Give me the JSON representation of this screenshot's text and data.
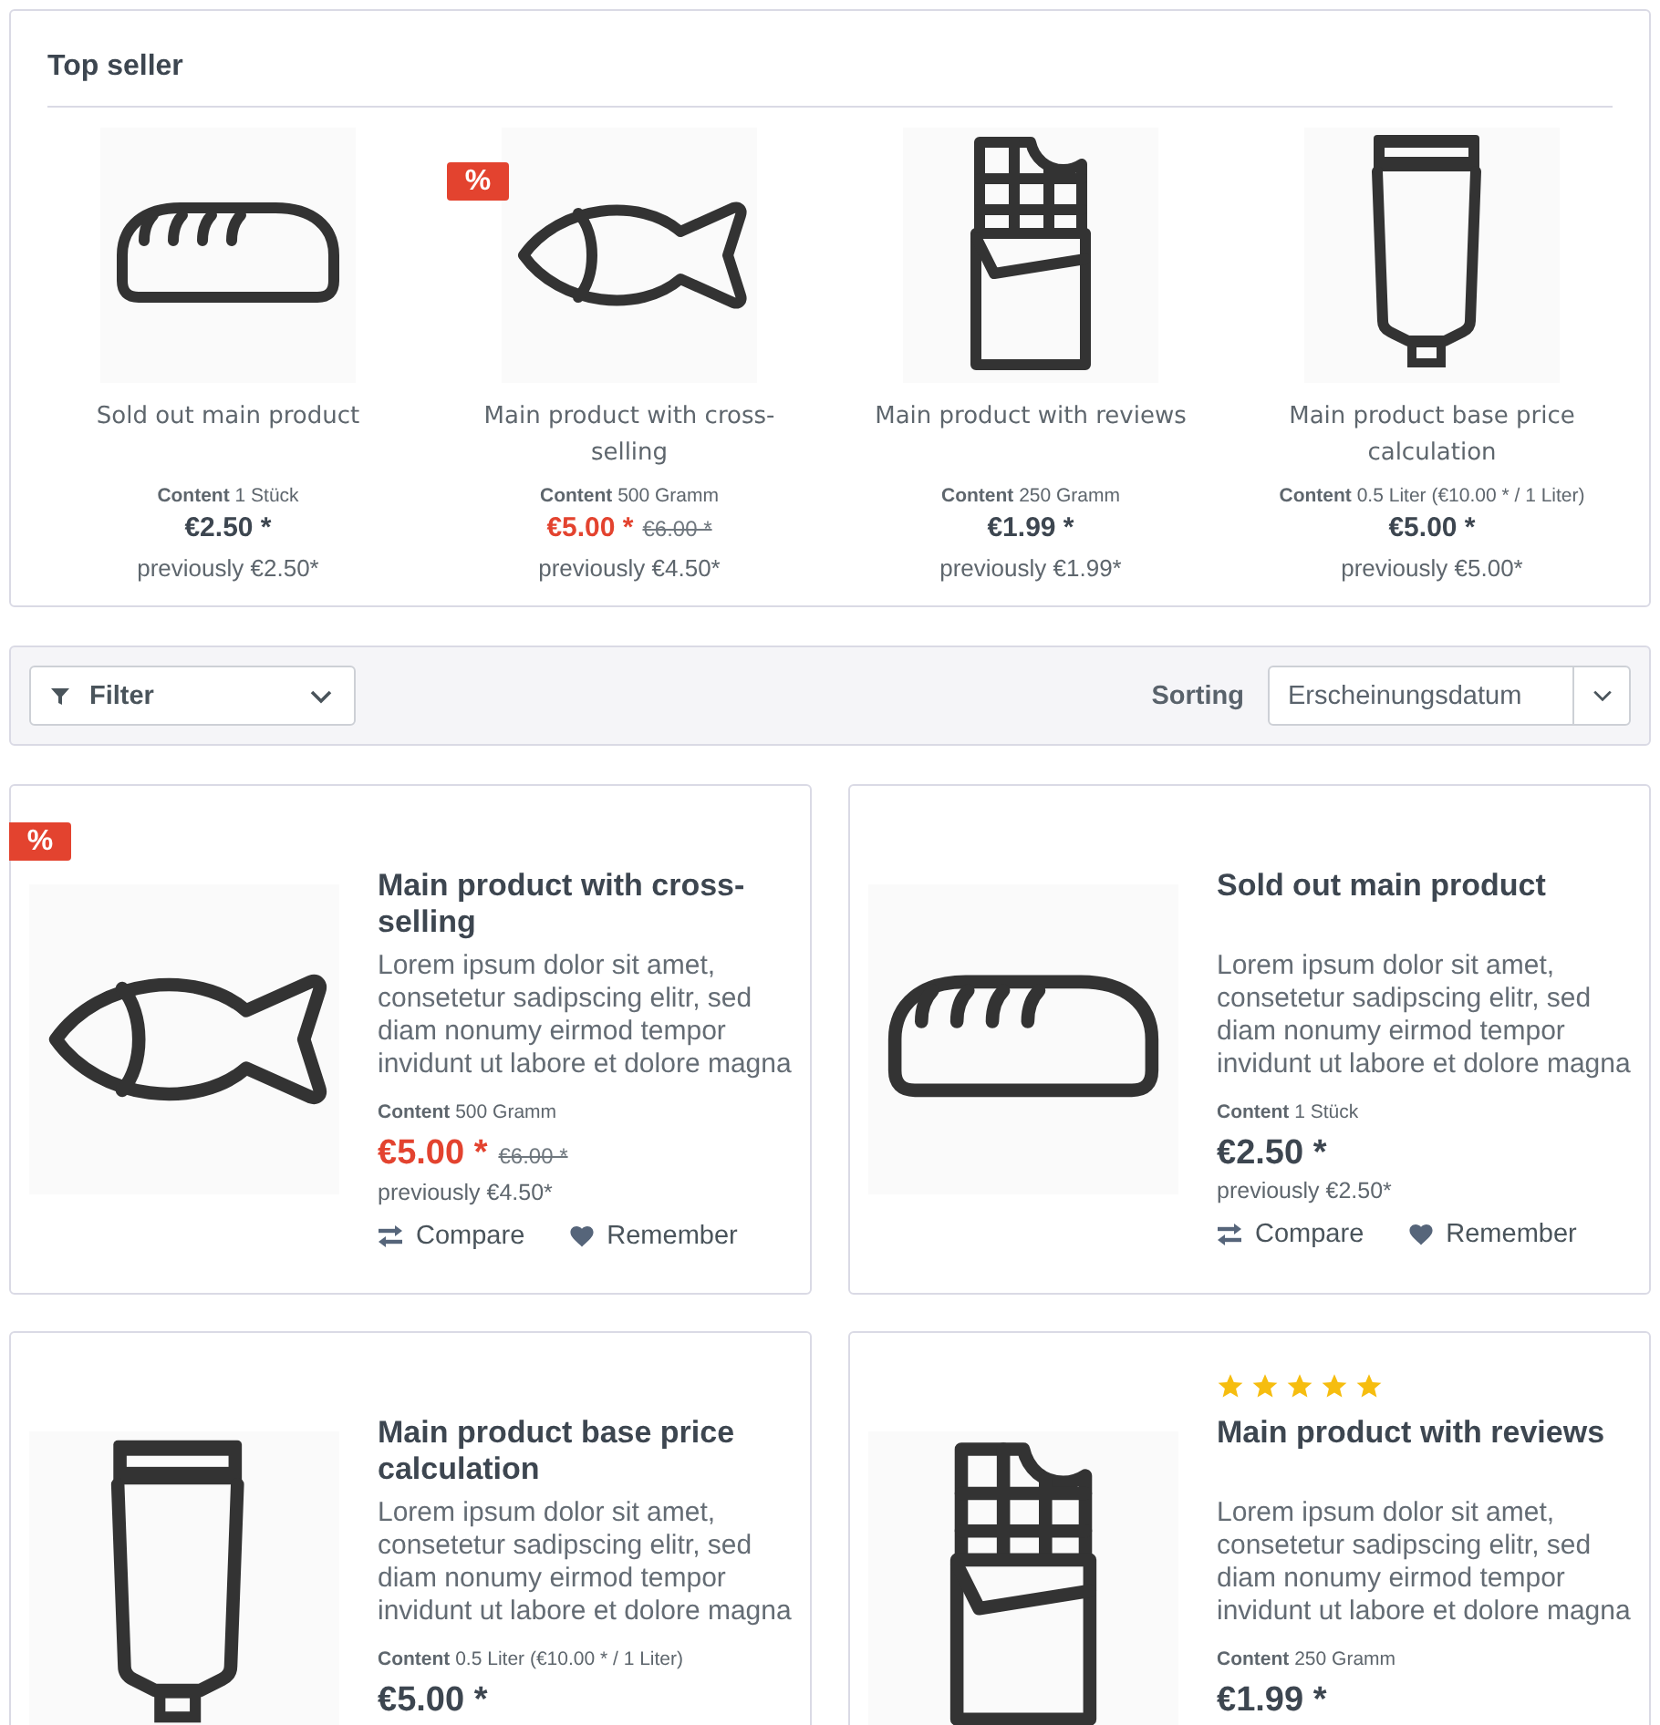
{
  "top_seller": {
    "title": "Top seller",
    "items": [
      {
        "kind": "bread",
        "name": "Sold out main product",
        "content": "**Content** 1 Stück",
        "price": "€2.50 *",
        "discounted": false,
        "previously": "previously €2.50*"
      },
      {
        "kind": "fish",
        "badge": "%",
        "name": "Main product with cross-selling",
        "content": "**Content** 500 Gramm",
        "price": "€5.00 *",
        "discounted": true,
        "list_price": "€6.00 *",
        "previously": "previously €4.50*"
      },
      {
        "kind": "chocolate",
        "name": "Main product with reviews",
        "content": "**Content** 250 Gramm",
        "price": "€1.99 *",
        "discounted": false,
        "previously": "previously €1.99*"
      },
      {
        "kind": "tube",
        "name": "Main product base price calculation",
        "content": "**Content** 0.5 Liter (€10.00 * / 1 Liter)",
        "price": "€5.00 *",
        "discounted": false,
        "previously": "previously €5.00*"
      }
    ]
  },
  "filter": {
    "label": "Filter"
  },
  "sorting": {
    "label": "Sorting",
    "value": "Erscheinungsdatum"
  },
  "products": [
    {
      "kind": "fish",
      "badge": "%",
      "name": "Main product with cross-selling",
      "description": "Lorem ipsum dolor sit amet, consetetur sadipscing elitr, sed diam nonumy eirmod tempor invidunt ut labore et dolore magna",
      "content": "**Content** 500 Gramm",
      "price": "€5.00 *",
      "discounted": true,
      "list_price": "€6.00 *",
      "previously": "previously €4.50*",
      "actions": [
        {
          "kind": "compare",
          "label": "Compare"
        },
        {
          "kind": "remember",
          "label": "Remember"
        }
      ]
    },
    {
      "kind": "bread",
      "name": "Sold out main product",
      "description": "Lorem ipsum dolor sit amet, consetetur sadipscing elitr, sed diam nonumy eirmod tempor invidunt ut labore et dolore magna",
      "content": "**Content** 1 Stück",
      "price": "€2.50 *",
      "discounted": false,
      "previously": "previously €2.50*",
      "actions": [
        {
          "kind": "compare",
          "label": "Compare"
        },
        {
          "kind": "remember",
          "label": "Remember"
        }
      ]
    },
    {
      "kind": "tube",
      "name": "Main product base price calculation",
      "description": "Lorem ipsum dolor sit amet, consetetur sadipscing elitr, sed diam nonumy eirmod tempor invidunt ut labore et dolore magna",
      "content": "**Content** 0.5 Liter (€10.00 * / 1 Liter)",
      "price": "€5.00 *",
      "discounted": false
    },
    {
      "kind": "chocolate",
      "stars": 5,
      "name": "Main product with reviews",
      "description": "Lorem ipsum dolor sit amet, consetetur sadipscing elitr, sed diam nonumy eirmod tempor invidunt ut labore et dolore magna",
      "content": "**Content** 250 Gramm",
      "price": "€1.99 *",
      "discounted": false
    }
  ]
}
